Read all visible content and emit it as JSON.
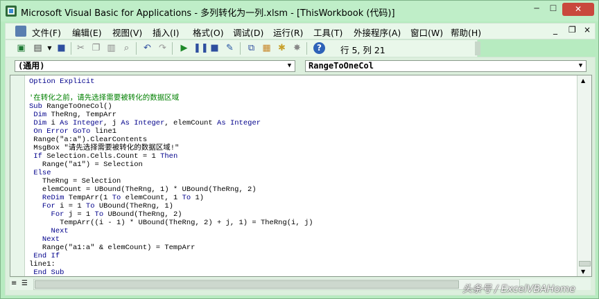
{
  "window": {
    "title": "Microsoft Visual Basic for Applications - 多列转化为一列.xlsm - [ThisWorkbook (代码)]",
    "min_label": "─",
    "max_label": "☐",
    "close_label": "✕"
  },
  "menubar": {
    "items": [
      "文件(F)",
      "编辑(E)",
      "视图(V)",
      "插入(I)",
      "格式(O)",
      "调试(D)",
      "运行(R)",
      "工具(T)",
      "外接程序(A)",
      "窗口(W)",
      "帮助(H)"
    ],
    "mdi_min": "_",
    "mdi_restore": "❐",
    "mdi_close": "×"
  },
  "toolbar": {
    "position_text": "行 5, 列 21",
    "icons": [
      "excel-icon",
      "insert-module-icon",
      "save-icon",
      "cut-icon",
      "copy-icon",
      "paste-icon",
      "find-icon",
      "undo-icon",
      "redo-icon",
      "run-icon",
      "break-icon",
      "reset-icon",
      "design-mode-icon",
      "project-explorer-icon",
      "properties-icon",
      "object-browser-icon",
      "toolbox-icon",
      "help-icon"
    ]
  },
  "combos": {
    "object": "(通用)",
    "procedure": "RangeToOneCol"
  },
  "code": {
    "lines": [
      "Option Explicit",
      "",
      "'在转化之前，请先选择需要被转化的数据区域",
      "Sub RangeToOneCol()",
      " Dim TheRng, TempArr",
      " Dim i As Integer, j As Integer, elemCount As Integer",
      " On Error GoTo line1",
      " Range(\"a:a\").ClearContents",
      " MsgBox \"请先选择需要被转化的数据区域!\"",
      " If Selection.Cells.Count = 1 Then",
      "   Range(\"a1\") = Selection",
      " Else",
      "   TheRng = Selection",
      "   elemCount = UBound(TheRng, 1) * UBound(TheRng, 2)",
      "   ReDim TempArr(1 To elemCount, 1 To 1)",
      "   For i = 1 To UBound(TheRng, 1)",
      "     For j = 1 To UBound(TheRng, 2)",
      "       TempArr((i - 1) * UBound(TheRng, 2) + j, 1) = TheRng(i, j)",
      "     Next",
      "   Next",
      "   Range(\"a1:a\" & elemCount) = TempArr",
      " End If",
      "line1:",
      " End Sub"
    ]
  },
  "watermark": "头条号 / ExcelVBAHome",
  "colors": {
    "frame": "#b7ebc0",
    "code_keyword": "#00008b",
    "code_comment": "#008000",
    "close_button": "#c9483d"
  }
}
